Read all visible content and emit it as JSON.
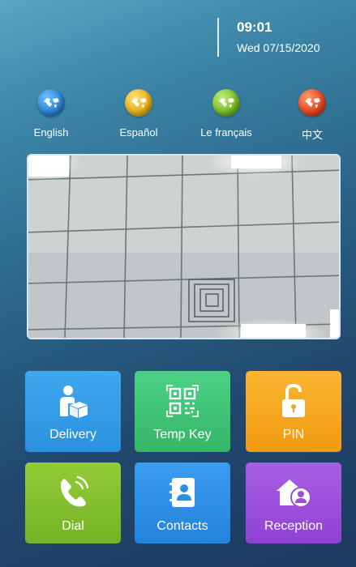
{
  "status": {
    "time": "09:01",
    "date": "Wed 07/15/2020"
  },
  "languages": [
    {
      "label": "English",
      "color": "#2f86d8"
    },
    {
      "label": "Español",
      "color": "#e7b21c"
    },
    {
      "label": "Le français",
      "color": "#7cbf2b"
    },
    {
      "label": "中文",
      "color": "#e84a24"
    }
  ],
  "tiles": [
    {
      "label": "Delivery",
      "color": "#2a97e6",
      "icon": "delivery-icon"
    },
    {
      "label": "Temp Key",
      "color": "#3fbf72",
      "icon": "qr-code-icon"
    },
    {
      "label": "PIN",
      "color": "#f5a41b",
      "icon": "unlock-icon"
    },
    {
      "label": "Dial",
      "color": "#7fbd2a",
      "icon": "phone-icon"
    },
    {
      "label": "Contacts",
      "color": "#2b8fe6",
      "icon": "contacts-icon"
    },
    {
      "label": "Reception",
      "color": "#9b4fd9",
      "icon": "reception-icon"
    }
  ]
}
